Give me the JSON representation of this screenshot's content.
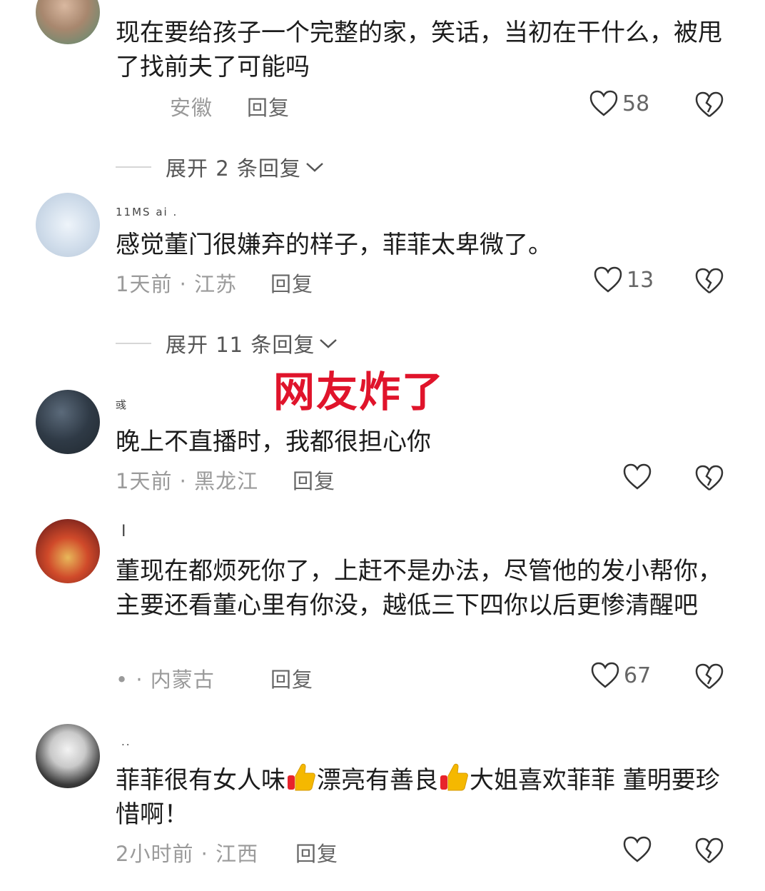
{
  "comments": [
    {
      "text": "现在要给孩子一个完整的家，笑话，当初在干什么，被甩了找前夫了可能吗",
      "meta": "安徽",
      "reply": "回复",
      "likes": "58"
    },
    {
      "username": "11MS  ai .",
      "text": "感觉董门很嫌弃的样子，菲菲太卑微了。",
      "meta": "1天前 · 江苏",
      "reply": "回复",
      "likes": "13"
    },
    {
      "username": "彧                                 ",
      "text": "晚上不直播时，我都很担心你",
      "meta": "1天前 · 黑龙江",
      "reply": "回复",
      "likes": ""
    },
    {
      "username": "I",
      "text": "董​现在都烦死你了，上赶不是办法，尽管他的发小帮你，主要还看董​心里有你没，越低三下四你以后更惨清醒吧",
      "meta": "• · 内蒙古",
      "reply": "回复",
      "likes": "67"
    },
    {
      "username": "..",
      "text_a": "菲菲很有女人味",
      "text_b": "漂亮有善良",
      "text_c": "大姐喜欢菲菲 董明要珍惜啊！",
      "meta": "2小时前 · 江西",
      "reply": "回复",
      "likes": ""
    }
  ],
  "expand": [
    {
      "label": "展开 2 条回复"
    },
    {
      "label": "展开 11 条回复"
    }
  ],
  "banner": "网友炸了",
  "colors": {
    "banner": "#e0142b",
    "meta": "#9a9a9a"
  }
}
